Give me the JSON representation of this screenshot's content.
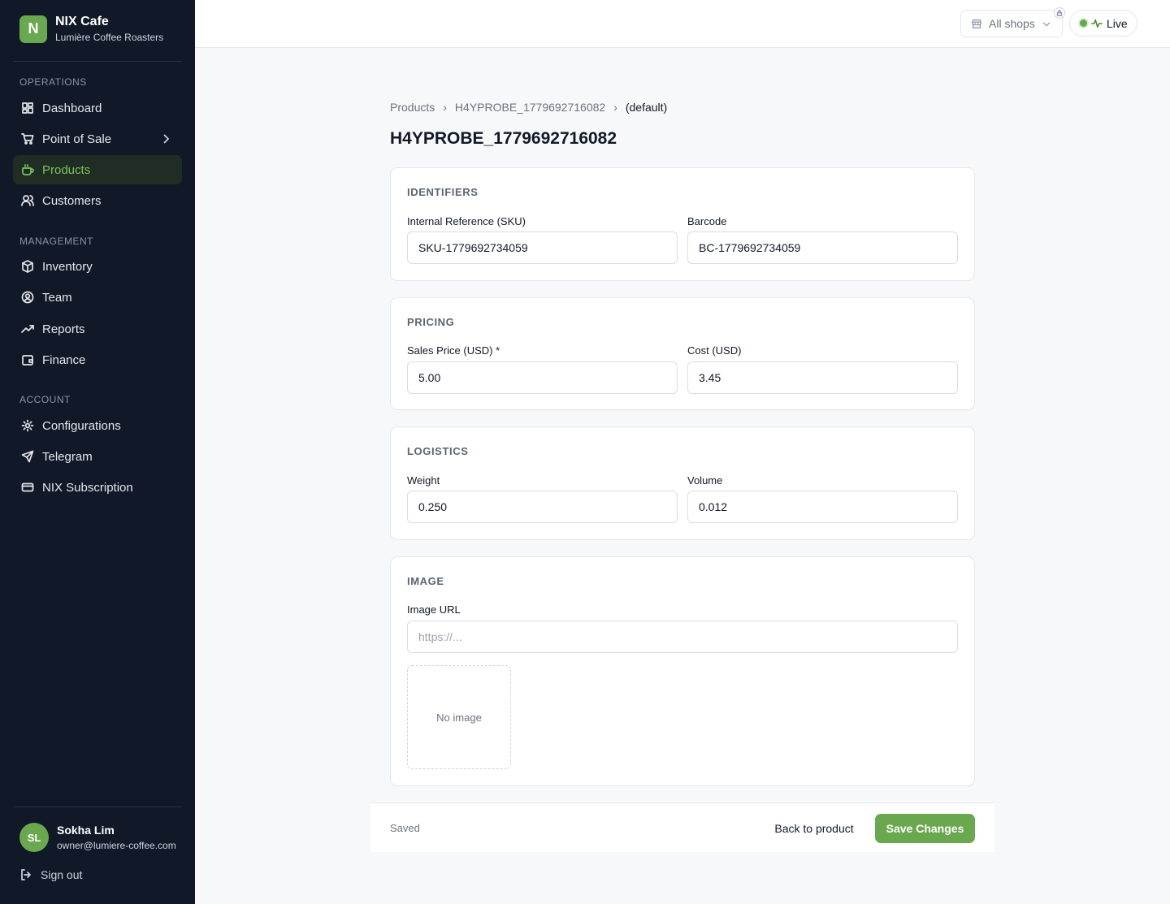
{
  "brand": {
    "logo_letter": "N",
    "name": "NIX Cafe",
    "subtitle": "Lumière Coffee Roasters"
  },
  "sidebar": {
    "sections": [
      {
        "title": "OPERATIONS",
        "items": [
          {
            "label": "Dashboard",
            "icon": "dashboard-icon"
          },
          {
            "label": "Point of Sale",
            "icon": "cart-icon",
            "has_submenu": true
          },
          {
            "label": "Products",
            "icon": "cup-icon",
            "active": true
          },
          {
            "label": "Customers",
            "icon": "users-icon"
          }
        ]
      },
      {
        "title": "MANAGEMENT",
        "items": [
          {
            "label": "Inventory",
            "icon": "box-icon"
          },
          {
            "label": "Team",
            "icon": "user-circle-icon"
          },
          {
            "label": "Reports",
            "icon": "trend-icon"
          },
          {
            "label": "Finance",
            "icon": "wallet-icon"
          }
        ]
      },
      {
        "title": "ACCOUNT",
        "items": [
          {
            "label": "Configurations",
            "icon": "gear-icon"
          },
          {
            "label": "Telegram",
            "icon": "send-icon"
          },
          {
            "label": "NIX Subscription",
            "icon": "card-icon"
          }
        ]
      }
    ],
    "user": {
      "initials": "SL",
      "name": "Sokha Lim",
      "email": "owner@lumiere-coffee.com"
    },
    "signout_label": "Sign out"
  },
  "topbar": {
    "shop_selector": "All shops",
    "live_label": "Live"
  },
  "breadcrumb": [
    "Products",
    "H4YPROBE_1779692716082",
    "(default)"
  ],
  "page_title": "H4YPROBE_1779692716082",
  "sections": {
    "identifiers": {
      "title": "IDENTIFIERS",
      "sku_label": "Internal Reference (SKU)",
      "sku_value": "SKU-1779692734059",
      "barcode_label": "Barcode",
      "barcode_value": "BC-1779692734059"
    },
    "pricing": {
      "title": "PRICING",
      "price_label": "Sales Price (USD) *",
      "price_value": "5.00",
      "cost_label": "Cost (USD)",
      "cost_value": "3.45"
    },
    "logistics": {
      "title": "LOGISTICS",
      "weight_label": "Weight",
      "weight_value": "0.250",
      "volume_label": "Volume",
      "volume_value": "0.012"
    },
    "image": {
      "title": "IMAGE",
      "url_label": "Image URL",
      "url_placeholder": "https://...",
      "empty_text": "No image"
    }
  },
  "footer": {
    "status": "Saved",
    "back_label": "Back to product",
    "save_label": "Save Changes"
  },
  "colors": {
    "accent": "#6aa84f",
    "sidebar_bg": "#111827"
  }
}
